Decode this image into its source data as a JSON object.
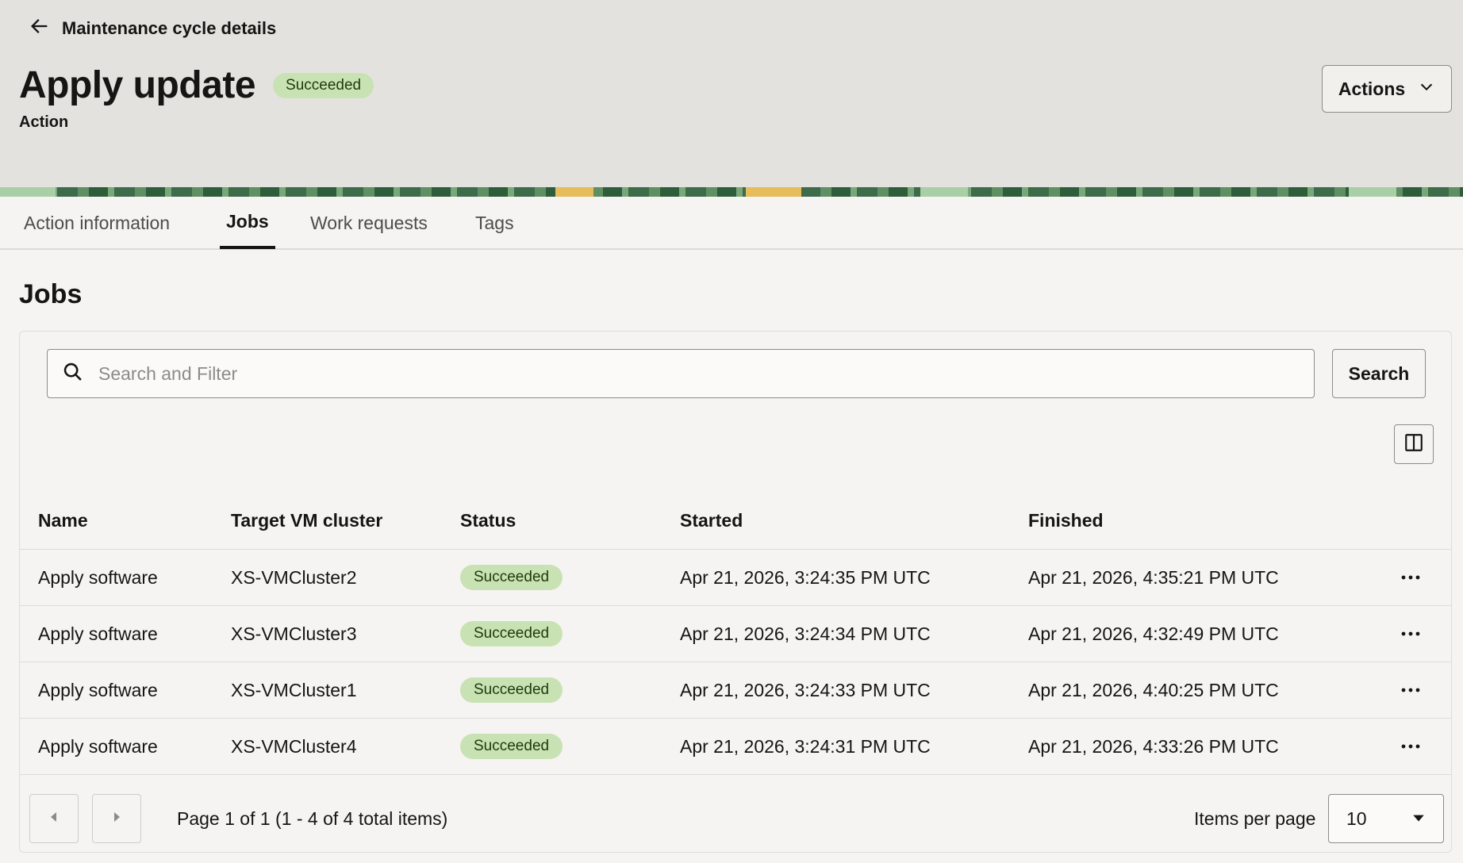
{
  "header": {
    "back_label": "Maintenance cycle details",
    "title": "Apply update",
    "status_badge": "Succeeded",
    "subtitle": "Action",
    "actions_label": "Actions"
  },
  "tabs": [
    {
      "label": "Action information",
      "active": false
    },
    {
      "label": "Jobs",
      "active": true
    },
    {
      "label": "Work requests",
      "active": false
    },
    {
      "label": "Tags",
      "active": false
    }
  ],
  "section": {
    "title": "Jobs"
  },
  "search": {
    "placeholder": "Search and Filter",
    "value": "",
    "button_label": "Search"
  },
  "table": {
    "columns": [
      "Name",
      "Target VM cluster",
      "Status",
      "Started",
      "Finished"
    ],
    "rows": [
      {
        "name": "Apply software",
        "cluster": "XS-VMCluster2",
        "status": "Succeeded",
        "started": "Apr 21, 2026, 3:24:35 PM UTC",
        "finished": "Apr 21, 2026, 4:35:21 PM UTC"
      },
      {
        "name": "Apply software",
        "cluster": "XS-VMCluster3",
        "status": "Succeeded",
        "started": "Apr 21, 2026, 3:24:34 PM UTC",
        "finished": "Apr 21, 2026, 4:32:49 PM UTC"
      },
      {
        "name": "Apply software",
        "cluster": "XS-VMCluster1",
        "status": "Succeeded",
        "started": "Apr 21, 2026, 3:24:33 PM UTC",
        "finished": "Apr 21, 2026, 4:40:25 PM UTC"
      },
      {
        "name": "Apply software",
        "cluster": "XS-VMCluster4",
        "status": "Succeeded",
        "started": "Apr 21, 2026, 3:24:31 PM UTC",
        "finished": "Apr 21, 2026, 4:33:26 PM UTC"
      }
    ]
  },
  "pagination": {
    "info": "Page 1 of 1 (1 - 4 of 4 total items)",
    "items_per_page_label": "Items per page",
    "items_per_page_value": "10"
  },
  "colors": {
    "accent_badge_bg": "#c9e2b3",
    "header_bg": "#e4e2de",
    "page_bg": "#f5f4f2"
  },
  "icons": {
    "back": "arrow-left-icon",
    "actions": "chevron-down-icon",
    "search": "search-icon",
    "columns": "columns-icon",
    "row_menu": "more-horizontal-icon"
  }
}
